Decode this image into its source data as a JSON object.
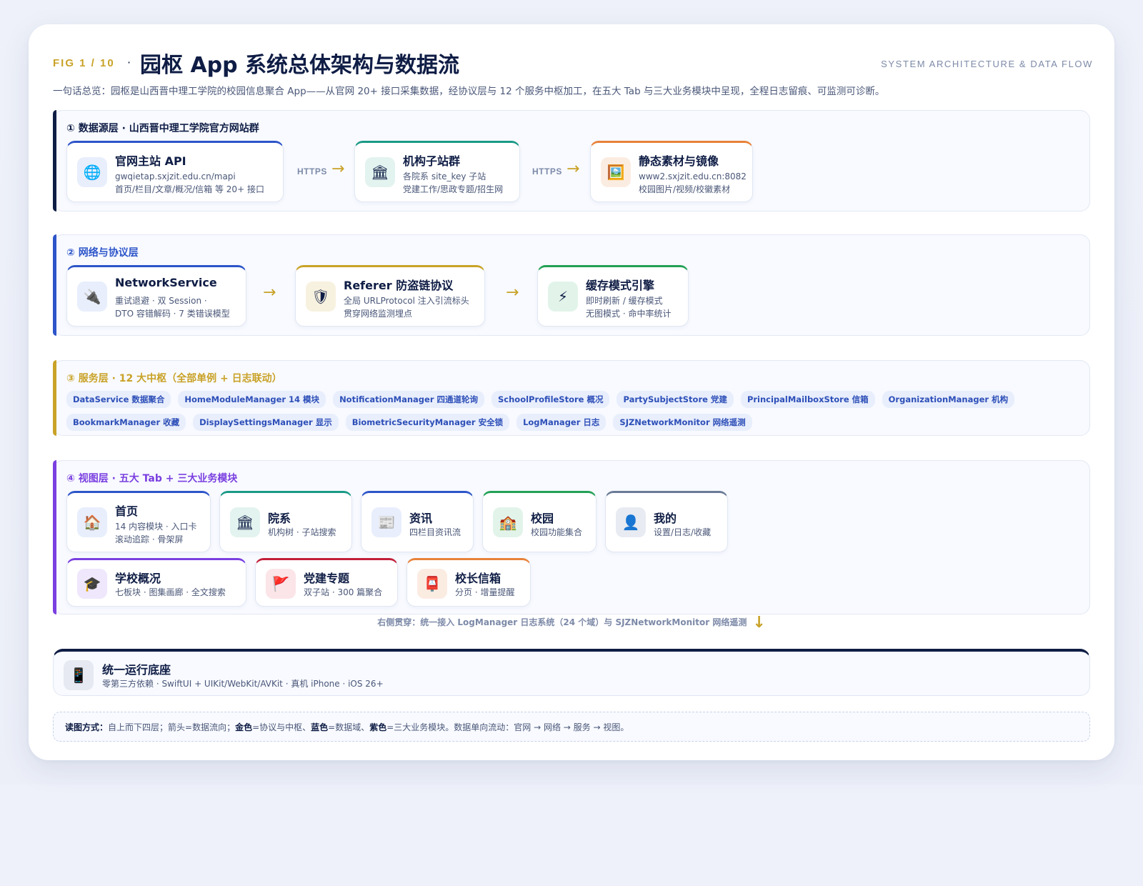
{
  "header": {
    "fig_tag": "FIG 1 / 10",
    "separator": "·",
    "title": "园枢 App 系统总体架构与数据流",
    "subtitle_en": "SYSTEM ARCHITECTURE & DATA FLOW",
    "summary": "一句话总览：园枢是山西晋中理工学院的校园信息聚合 App——从官网 20+ 接口采集数据，经协议层与 12 个服务中枢加工，在五大 Tab 与三大业务模块中呈现，全程日志留痕、可监测可诊断。"
  },
  "colors": {
    "navy": "#0f1d45",
    "gold": "#c9a227",
    "blue": "#2d55c9",
    "teal": "#1a9a86",
    "orange": "#e8823a",
    "green": "#22a155",
    "purple": "#7a3fe0",
    "red": "#c21f3a",
    "gray": "#6b7b96"
  },
  "layer1": {
    "title": "① 数据源层 · 山西晋中理工学院官方网站群",
    "nodes": [
      {
        "icon": "globe-icon",
        "glyph": "🌐",
        "title": "官网主站 API",
        "line1": "gwqietap.sxjzit.edu.cn/mapi",
        "line2": "首页/栏目/文章/概况/信箱 等 20+ 接口"
      },
      {
        "icon": "institution-icon",
        "glyph": "🏛",
        "title": "机构子站群",
        "line1": "各院系 site_key 子站",
        "line2": "党建工作/思政专题/招生网"
      },
      {
        "icon": "picture-icon",
        "glyph": "🖼️",
        "title": "静态素材与镜像",
        "line1": "www2.sxjzit.edu.cn:8082",
        "line2": "校园图片/视频/校徽素材"
      }
    ],
    "arrow_label": "HTTPS",
    "arrow_glyph": "→"
  },
  "layer2": {
    "title": "② 网络与协议层",
    "nodes": [
      {
        "icon": "plug-icon",
        "glyph": "🔌",
        "title": "NetworkService",
        "line1": "重试退避 · 双 Session ·",
        "line2": "DTO 容错解码 · 7 类错误模型"
      },
      {
        "icon": "shield-icon",
        "glyph": "🛡",
        "title": "Referer 防盗链协议",
        "line1": "全局 URLProtocol 注入引流标头",
        "line2": "贯穿网络监测埋点"
      },
      {
        "icon": "lightning-icon",
        "glyph": "⚡",
        "title": "缓存模式引擎",
        "line1": "即时刷新 / 缓存模式",
        "line2": "无图模式 · 命中率统计"
      }
    ],
    "arrow_glyph": "→"
  },
  "layer3": {
    "title": "③ 服务层 · 12 大中枢（全部单例 + 日志联动）",
    "chips": [
      "DataService 数据聚合",
      "HomeModuleManager 14 模块",
      "NotificationManager 四通道轮询",
      "SchoolProfileStore 概况",
      "PartySubjectStore 党建",
      "PrincipalMailboxStore 信箱",
      "OrganizationManager 机构",
      "BookmarkManager 收藏",
      "DisplaySettingsManager 显示",
      "BiometricSecurityManager 安全锁",
      "LogManager 日志",
      "SJZNetworkMonitor 网络遥测"
    ]
  },
  "layer4": {
    "title": "④ 视图层 · 五大 Tab + 三大业务模块",
    "tabs": [
      {
        "icon": "house-icon",
        "glyph": "🏠",
        "title": "首页",
        "line1": "14 内容模块 · 入口卡",
        "line2": "滚动追踪 · 骨架屏"
      },
      {
        "icon": "institution-icon",
        "glyph": "🏛",
        "title": "院系",
        "line1": "机构树 · 子站搜索",
        "line2": ""
      },
      {
        "icon": "newspaper-icon",
        "glyph": "📰",
        "title": "资讯",
        "line1": "四栏目资讯流",
        "line2": ""
      },
      {
        "icon": "school-icon",
        "glyph": "🏫",
        "title": "校园",
        "line1": "校园功能集合",
        "line2": ""
      },
      {
        "icon": "user-icon",
        "glyph": "👤",
        "title": "我的",
        "line1": "设置/日志/收藏",
        "line2": ""
      }
    ],
    "modules": [
      {
        "icon": "graduation-cap-icon",
        "glyph": "🎓",
        "title": "学校概况",
        "line1": "七板块 · 图集画廊 · 全文搜索"
      },
      {
        "icon": "flag-icon",
        "glyph": "🚩",
        "title": "党建专题",
        "line1": "双子站 · 300 篇聚合"
      },
      {
        "icon": "mailbox-icon",
        "glyph": "📮",
        "title": "校长信箱",
        "line1": "分页 · 增量提醒"
      }
    ]
  },
  "thread": {
    "text": "右侧贯穿：统一接入 LogManager 日志系统（24 个域）与 SJZNetworkMonitor 网络遥测",
    "arrow_glyph": "↓"
  },
  "base": {
    "icon": "phone-icon",
    "glyph": "📱",
    "title": "统一运行底座",
    "desc": "零第三方依赖 · SwiftUI + UIKit/WebKit/AVKit · 真机 iPhone · iOS 26+"
  },
  "legend": {
    "label": "读图方式：",
    "t1": "自上而下四层；箭头=数据流向；",
    "gold": "金色",
    "t2": "=协议与中枢、",
    "blue": "蓝色",
    "t3": "=数据域、",
    "purple": "紫色",
    "t4": "=三大业务模块。数据单向流动：官网 → 网络 → 服务 → 视图。"
  }
}
